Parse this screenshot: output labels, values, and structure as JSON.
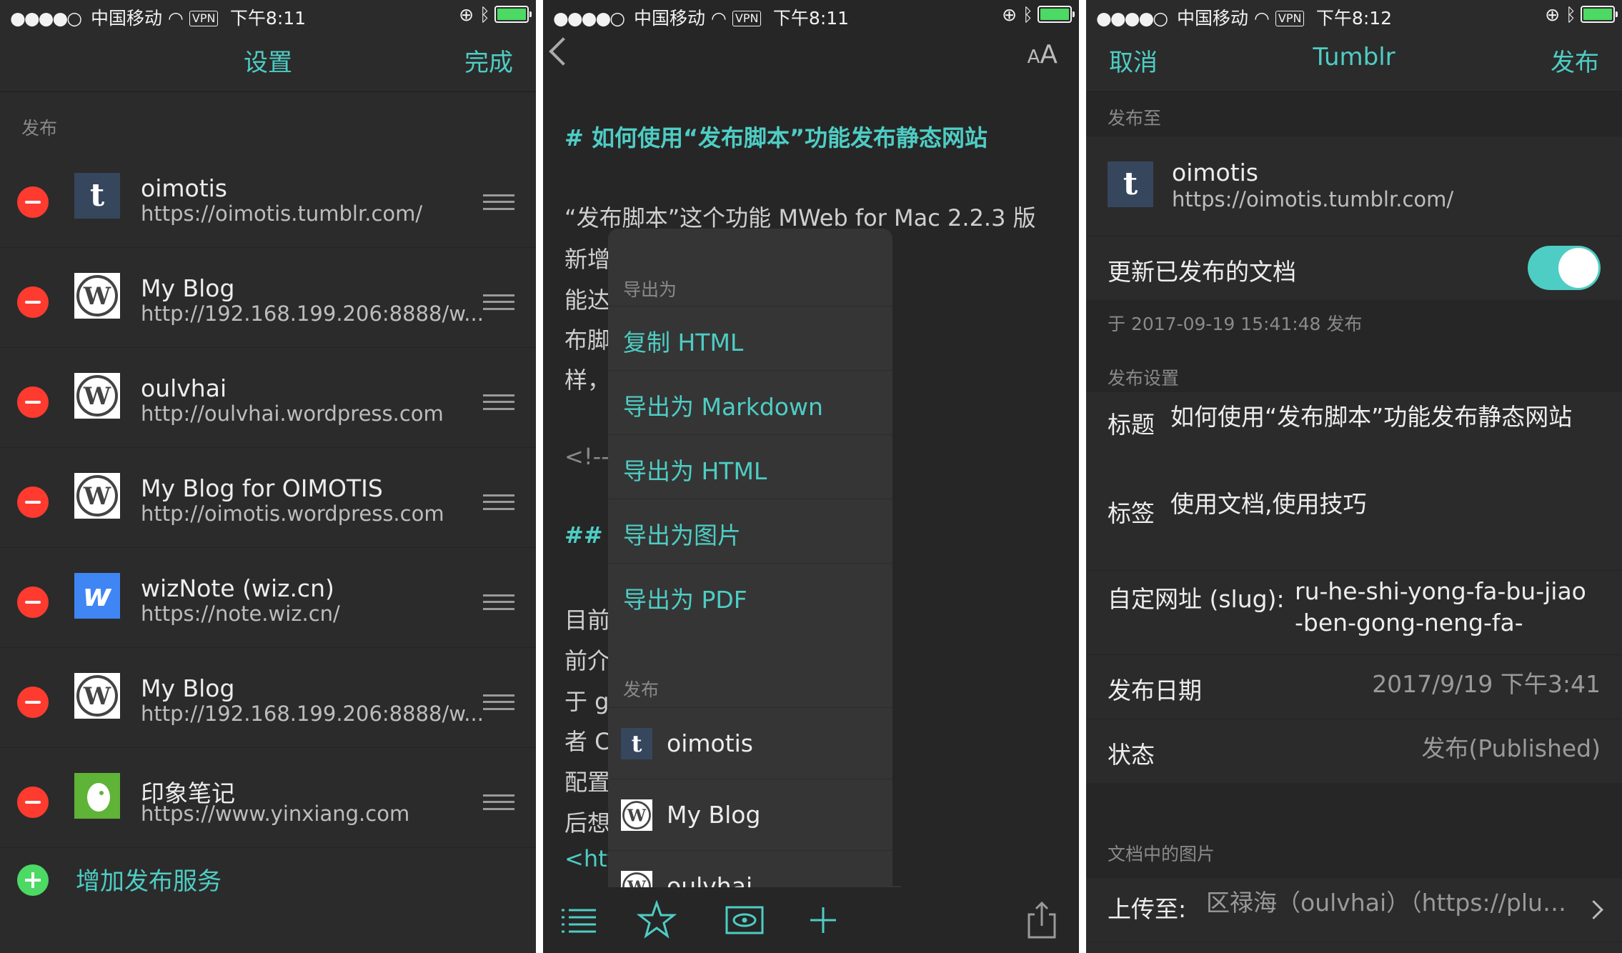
{
  "status_bar": {
    "carrier": "中国移动",
    "vpn": "VPN",
    "time_left": "下午8:11",
    "time_middle": "下午8:11",
    "time_right": "下午8:12"
  },
  "settings": {
    "title": "设置",
    "done": "完成",
    "section": "发布",
    "services": [
      {
        "icon": "tumblr-icon",
        "name": "oimotis",
        "url": "https://oimotis.tumblr.com/"
      },
      {
        "icon": "wordpress-icon",
        "name": "My Blog",
        "url": "http://192.168.199.206:8888/w..."
      },
      {
        "icon": "wordpress-icon",
        "name": "oulvhai",
        "url": "http://oulvhai.wordpress.com"
      },
      {
        "icon": "wordpress-icon",
        "name": "My Blog for OIMOTIS",
        "url": "http://oimotis.wordpress.com"
      },
      {
        "icon": "wiz-icon",
        "name": "wizNote (wiz.cn)",
        "url": "https://note.wiz.cn/"
      },
      {
        "icon": "wordpress-icon",
        "name": "My Blog",
        "url": "http://192.168.199.206:8888/w..."
      },
      {
        "icon": "evernote-icon",
        "name": "印象笔记",
        "url": "https://www.yinxiang.com"
      }
    ],
    "add_service": "增加发布服务"
  },
  "editor": {
    "font_size_label": "AA",
    "heading": "# 如何使用“发布脚本”功能发布静态网站",
    "lines": [
      "“发布脚本”这个功能 MWeb for Mac 2.2.3 版",
      "新增",
      "能达",
      "布脚",
      "样，",
      "<!--",
      "## 1",
      "目前",
      "前介",
      "于 g",
      "者 C",
      "配置",
      "后想",
      "<htt"
    ],
    "menu": {
      "export_section": "导出为",
      "export_items": [
        "复制 HTML",
        "导出为 Markdown",
        "导出为 HTML",
        "导出为图片",
        "导出为 PDF"
      ],
      "publish_section": "发布",
      "publish_items": [
        {
          "icon": "tumblr-icon",
          "name": "oimotis"
        },
        {
          "icon": "wordpress-icon",
          "name": "My Blog"
        },
        {
          "icon": "wordpress-icon",
          "name": "oulvhai"
        }
      ]
    },
    "toolbar": [
      "list-icon",
      "star-icon",
      "preview-eye-icon",
      "plus-icon",
      "share-icon"
    ]
  },
  "publish": {
    "cancel": "取消",
    "title": "Tumblr",
    "publish": "发布",
    "publish_to_label": "发布至",
    "account_name": "oimotis",
    "account_url": "https://oimotis.tumblr.com/",
    "update_label": "更新已发布的文档",
    "update_on": true,
    "published_note": "于 2017-09-19 15:41:48 发布",
    "settings_label": "发布设置",
    "title_key": "标题",
    "title_value": "如何使用“发布脚本”功能发布静态网站",
    "tags_key": "标签",
    "tags_value": "使用文档,使用技巧",
    "slug_key": "自定网址 (slug):",
    "slug_value": "ru-he-shi-yong-fa-bu-jiao-ben-gong-neng-fa-",
    "date_key": "发布日期",
    "date_value": "2017/9/19 下午3:41",
    "state_key": "状态",
    "state_value": "发布(Published)",
    "images_label": "文档中的图片",
    "upload_key": "上传至:",
    "upload_value": "区禄海（oulvhai）（https://plus...."
  },
  "colors": {
    "accent": "#4ecdc4",
    "background": "#2b2b2b",
    "delete": "#ff3b30",
    "add": "#4cd964"
  }
}
